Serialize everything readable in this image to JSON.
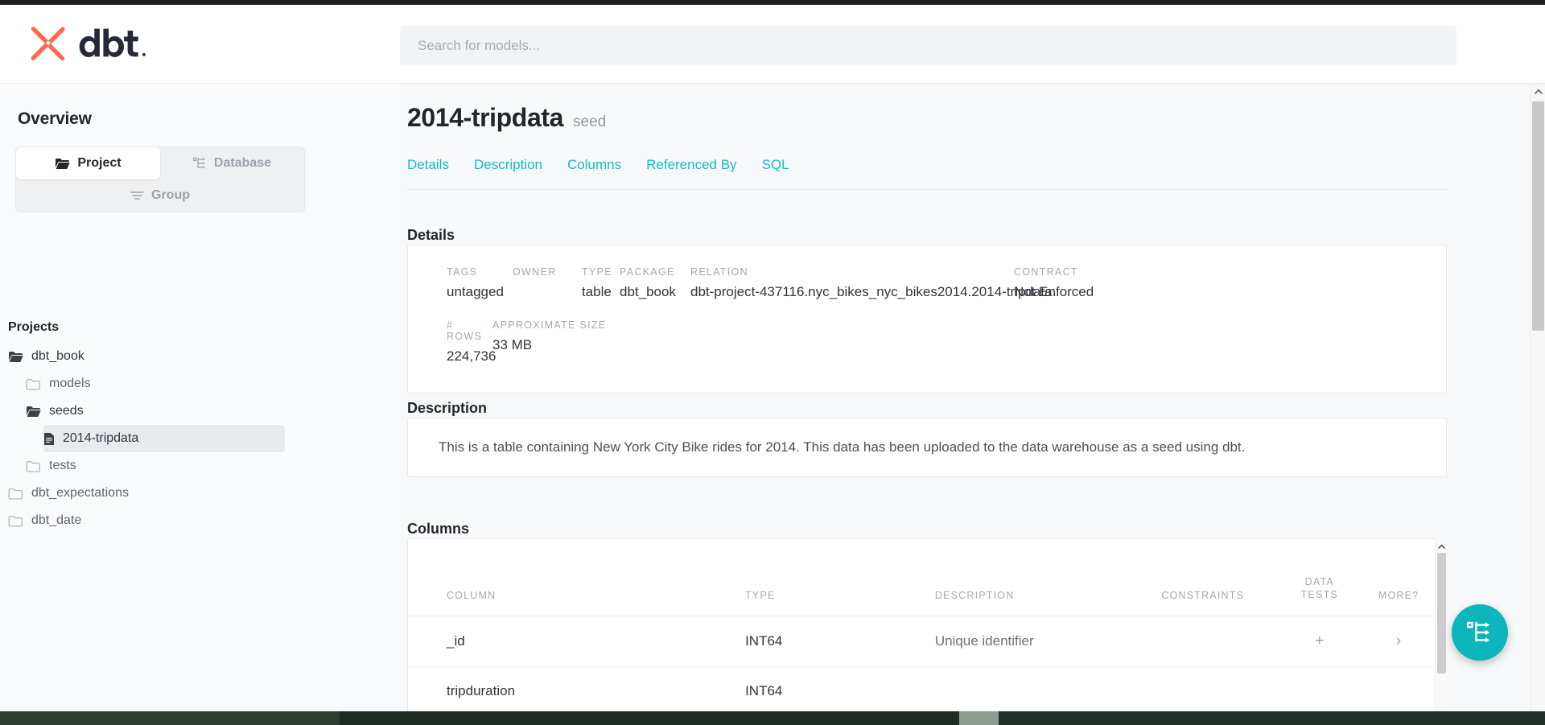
{
  "brand": {
    "name": "dbt",
    "logo_color": "#ff694a",
    "wordmark_color": "#262a38",
    "accent_color": "#0db5bd",
    "link_color": "#17b8c4"
  },
  "search": {
    "placeholder": "Search for models...",
    "value": ""
  },
  "sidebar": {
    "title": "Overview",
    "tabs": [
      {
        "label": "Project",
        "icon": "folder-open-icon",
        "active": true
      },
      {
        "label": "Database",
        "icon": "database-tree-icon",
        "active": false
      },
      {
        "label": "Group",
        "icon": "group-filter-icon",
        "active": false
      }
    ],
    "projects_label": "Projects",
    "tree": [
      {
        "label": "dbt_book",
        "icon": "folder-open-icon",
        "indent": 1,
        "selected": false
      },
      {
        "label": "models",
        "icon": "folder-closed-icon",
        "indent": 2,
        "selected": false
      },
      {
        "label": "seeds",
        "icon": "folder-open-icon",
        "indent": 2,
        "selected": false
      },
      {
        "label": "2014-tripdata",
        "icon": "file-icon",
        "indent": 3,
        "selected": true
      },
      {
        "label": "tests",
        "icon": "folder-closed-icon",
        "indent": 2,
        "selected": false
      },
      {
        "label": "dbt_expectations",
        "icon": "folder-closed-icon",
        "indent": 1,
        "selected": false
      },
      {
        "label": "dbt_date",
        "icon": "folder-closed-icon",
        "indent": 1,
        "selected": false
      }
    ]
  },
  "main": {
    "title": "2014-tripdata",
    "subtype": "seed",
    "tabs": [
      {
        "label": "Details"
      },
      {
        "label": "Description"
      },
      {
        "label": "Columns"
      },
      {
        "label": "Referenced By"
      },
      {
        "label": "SQL"
      }
    ],
    "details": {
      "heading": "Details",
      "row1": [
        {
          "label": "TAGS",
          "value": "untagged"
        },
        {
          "label": "OWNER",
          "value": ""
        },
        {
          "label": "TYPE",
          "value": "table"
        },
        {
          "label": "PACKAGE",
          "value": "dbt_book"
        },
        {
          "label": "RELATION",
          "value": "dbt-project-437116.nyc_bikes_nyc_bikes2014.2014-tripdata"
        },
        {
          "label": "CONTRACT",
          "value": "Not Enforced"
        }
      ],
      "row2": [
        {
          "label": "# ROWS",
          "value": "224,736"
        },
        {
          "label": "APPROXIMATE SIZE",
          "value": "33 MB"
        }
      ]
    },
    "description": {
      "heading": "Description",
      "text": "This is a table containing New York City Bike rides for 2014. This data has been uploaded to the data warehouse as a seed using dbt."
    },
    "columns": {
      "heading": "Columns",
      "headers": {
        "column": "COLUMN",
        "type": "TYPE",
        "description": "DESCRIPTION",
        "constraints": "CONSTRAINTS",
        "data_tests_line1": "DATA",
        "data_tests_line2": "TESTS",
        "more": "MORE?"
      },
      "rows": [
        {
          "column": "_id",
          "type": "INT64",
          "description": "Unique identifier",
          "constraints": "",
          "data_tests": "+",
          "more": "›"
        },
        {
          "column": "tripduration",
          "type": "INT64",
          "description": "",
          "constraints": "",
          "data_tests": "",
          "more": ""
        }
      ]
    }
  },
  "fab": {
    "icon": "lineage-graph-icon",
    "color": "#0db5bd"
  },
  "taskbar": {
    "clock": ""
  }
}
